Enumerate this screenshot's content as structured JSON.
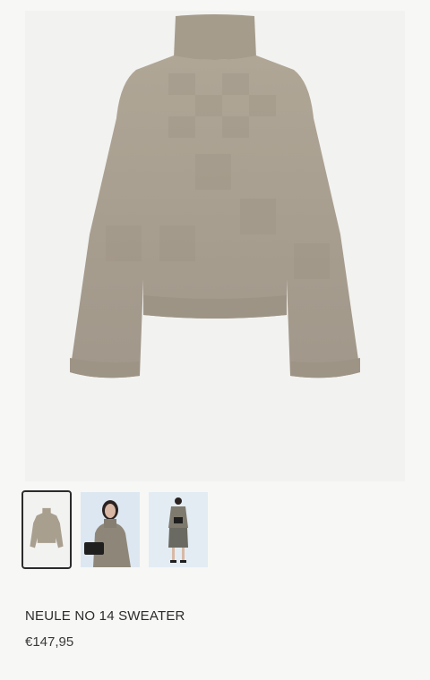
{
  "product": {
    "name": "NEULE NO 14 SWEATER",
    "price": "€147,95"
  },
  "gallery": {
    "main_image": "sweater-product-photo",
    "thumbnails": [
      {
        "content": "sweater-flatlay-thumbnail",
        "selected": true
      },
      {
        "content": "model-with-clutch-thumbnail",
        "selected": false
      },
      {
        "content": "model-full-body-thumbnail",
        "selected": false
      }
    ]
  },
  "colors": {
    "background": "#f7f7f5",
    "image_bg": "#f2f2f0",
    "sweater": "#a99f8f",
    "thumb_bg": "#dfe8f2",
    "text": "#2b2b2b"
  }
}
